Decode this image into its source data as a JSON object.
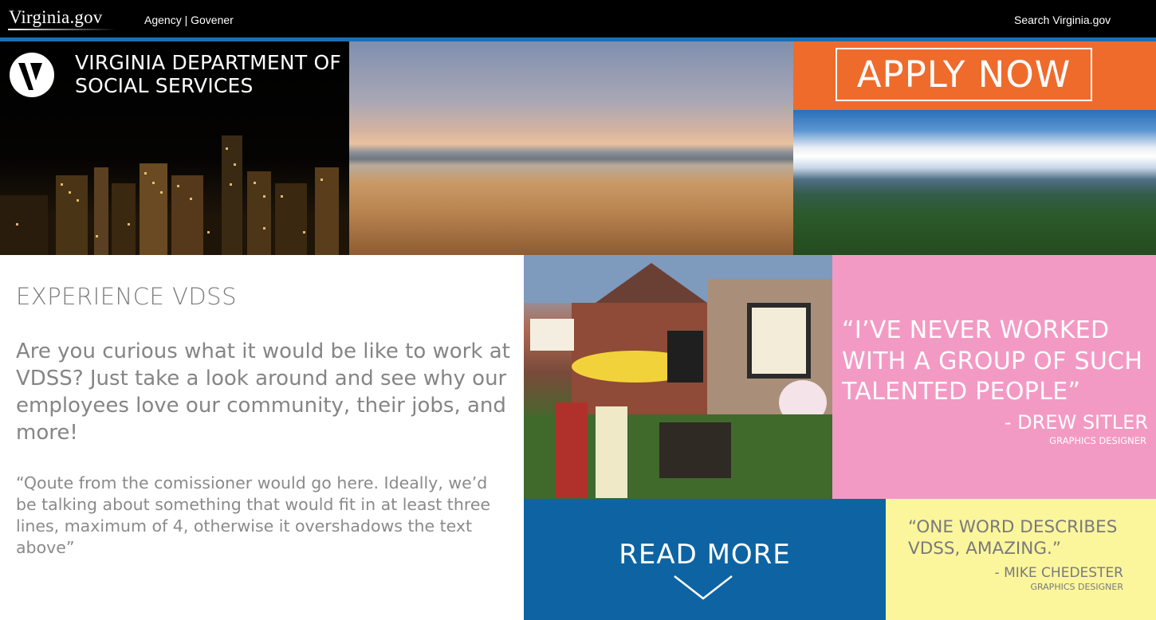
{
  "topbar": {
    "logo": "Virginia.gov",
    "agency_link": "Agency | Govener",
    "search_link": "Search Virginia.gov"
  },
  "brand": {
    "line1": "VIRGINIA DEPARTMENT OF",
    "line2": "SOCIAL SERVICES"
  },
  "apply": {
    "label": "APPLY NOW"
  },
  "experience": {
    "title": "EXPERIENCE VDSS",
    "body": "Are you curious what it would be like to work at VDSS? Just take a look around and see why our employees love our community, their jobs, and more!",
    "quote": "“Qoute from the comissioner would go here.  Ideally, we’d be talking about something that would fit in at least three lines, maximum of 4, otherwise it overshadows the text above”"
  },
  "testimonial_pink": {
    "quote": "“I’VE NEVER WORKED WITH A GROUP OF SUCH TALENTED PEOPLE”",
    "author": "- DREW SITLER",
    "role": "GRAPHICS DESIGNER"
  },
  "read_more": {
    "label": "READ MORE"
  },
  "testimonial_yellow": {
    "quote": "“ONE WORD DESCRIBES VDSS, AMAZING.”",
    "author": "- MIKE CHEDESTER",
    "role": "GRAPHICS DESIGNER"
  },
  "colors": {
    "topbar": "#000000",
    "accent_blue": "#1b6fb3",
    "apply_orange": "#ef6b2c",
    "quote_pink": "#f39ac4",
    "read_more_blue": "#0e64a3",
    "quote_yellow": "#fbf59c"
  },
  "icons": {
    "brand": "vdss-v-logo-icon",
    "read_more": "chevron-down-icon"
  }
}
